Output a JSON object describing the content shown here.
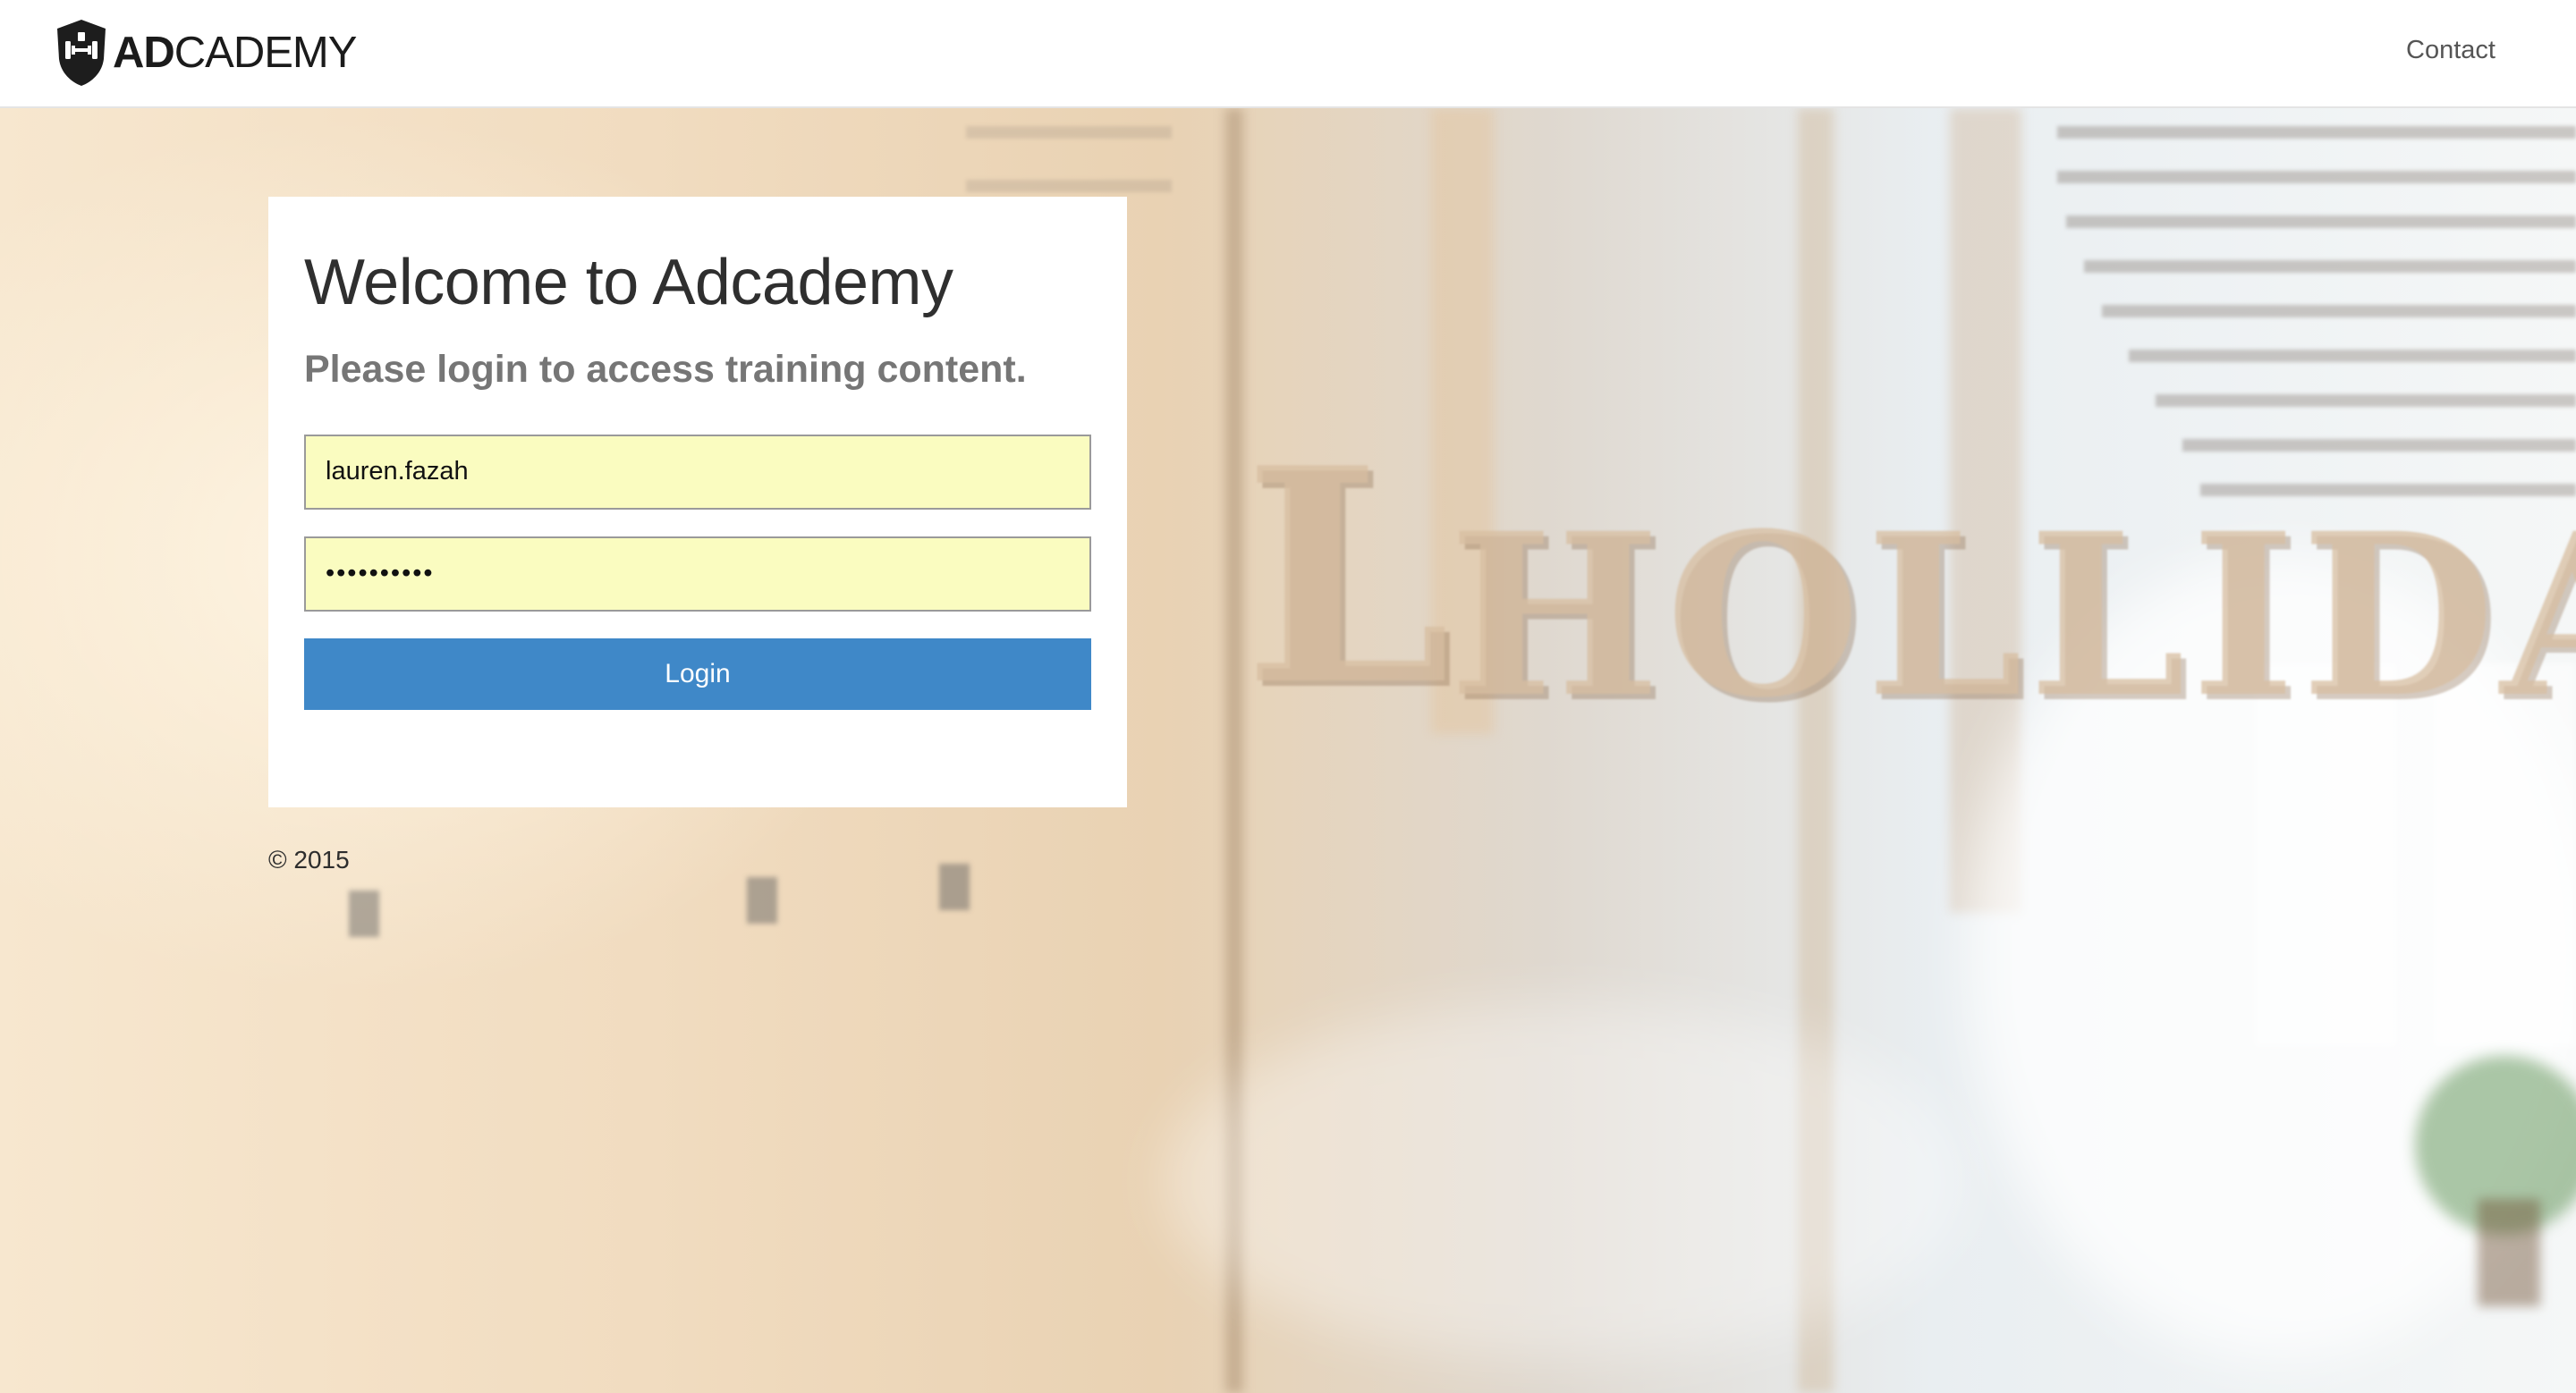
{
  "brand": {
    "bold": "AD",
    "light": "CADEMY",
    "icon": "shield-dumbbell-icon"
  },
  "nav": {
    "contact_label": "Contact"
  },
  "login": {
    "title": "Welcome to Adcademy",
    "subtitle": "Please login to access training content.",
    "username_value": "lauren.fazah",
    "password_value": "••••••••••",
    "button_label": "Login"
  },
  "footer": {
    "copyright": "© 2015"
  },
  "colors": {
    "button": "#3f88c8",
    "autofill": "#fafcc0",
    "nav_bg": "#ffffff"
  }
}
